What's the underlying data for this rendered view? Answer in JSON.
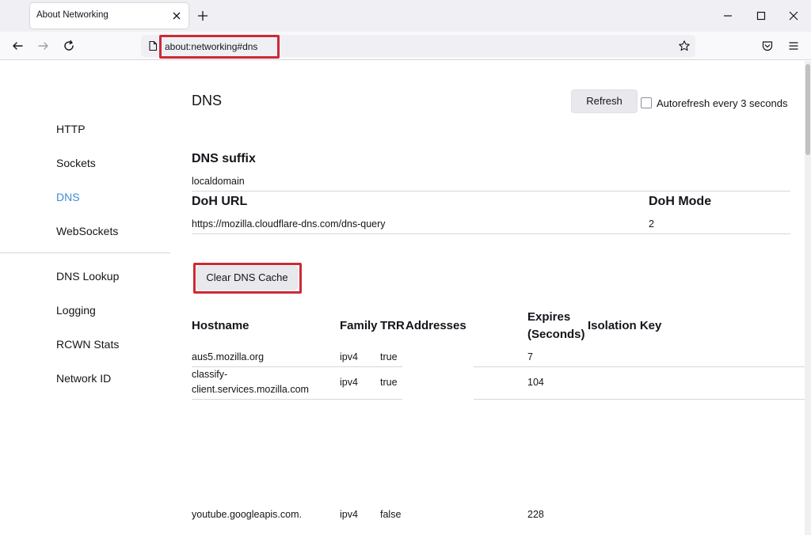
{
  "browser": {
    "tab_title": "About Networking",
    "url": "about:networking#dns"
  },
  "sidebar": {
    "items": [
      {
        "label": "HTTP"
      },
      {
        "label": "Sockets"
      },
      {
        "label": "DNS"
      },
      {
        "label": "WebSockets"
      },
      {
        "label": "DNS Lookup"
      },
      {
        "label": "Logging"
      },
      {
        "label": "RCWN Stats"
      },
      {
        "label": "Network ID"
      }
    ],
    "active_index": 2
  },
  "page": {
    "title": "DNS",
    "refresh_label": "Refresh",
    "autorefresh_label": "Autorefresh every 3 seconds",
    "autorefresh_checked": false
  },
  "dns_suffix": {
    "header": "DNS suffix",
    "value": "localdomain"
  },
  "doh": {
    "url_header": "DoH URL",
    "mode_header": "DoH Mode",
    "url": "https://mozilla.cloudflare-dns.com/dns-query",
    "mode": "2"
  },
  "clear_cache_label": "Clear DNS Cache",
  "dns_table": {
    "headers": {
      "hostname": "Hostname",
      "family": "Family",
      "trr": "TRR",
      "addresses": "Addresses",
      "expires_line1": "Expires",
      "expires_line2": "(Seconds)",
      "isolation": "Isolation Key"
    },
    "rows": [
      {
        "hostname": "aus5.mozilla.org",
        "family": "ipv4",
        "trr": "true",
        "expires": "7"
      },
      {
        "hostname_line1": "classify-",
        "hostname_line2": "client.services.mozilla.com",
        "family": "ipv4",
        "trr": "true",
        "expires": "104"
      },
      {
        "hostname": "youtube.googleapis.com.",
        "family": "ipv4",
        "trr": "false",
        "expires": "228"
      }
    ]
  },
  "colors": {
    "accent_active": "#3b8ed6",
    "highlight_box": "#cc2a36",
    "chrome_bg": "#f0f0f4"
  }
}
